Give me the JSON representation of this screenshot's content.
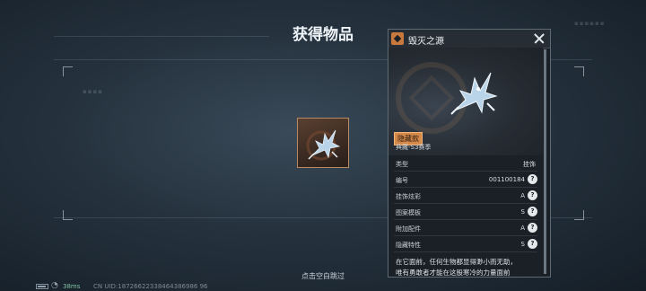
{
  "screen": {
    "title": "获得物品",
    "skip_hint": "点击空白跳过",
    "ping": "38ms",
    "uid": "CN UID:18726622338464386986 96"
  },
  "panel": {
    "title": "毁灭之源",
    "tag": "隐藏款",
    "collection": "典藏-S3赛季",
    "rows": [
      {
        "label": "类型",
        "value": "挂饰",
        "help": ""
      },
      {
        "label": "编号",
        "value": "001100184",
        "help": "?"
      },
      {
        "label": "挂饰炫彩",
        "value": "A",
        "help": "?"
      },
      {
        "label": "图案模板",
        "value": "S",
        "help": "?"
      },
      {
        "label": "附加配件",
        "value": "A",
        "help": "?"
      },
      {
        "label": "隐藏特性",
        "value": "S",
        "help": "?"
      }
    ],
    "description_line1": "在它面前，任何生物都显得渺小而无助，",
    "description_line2": "唯有勇敢者才能在这股寒冷的力量面前"
  },
  "colors": {
    "accent_orange": "#d58a4a",
    "panel_bg": "#1b2026",
    "background": "#25323e"
  },
  "icons": {
    "item": "dragon-ornament-icon",
    "close": "close-icon",
    "help": "question-mark-icon",
    "rarity": "diamond-badge-icon"
  }
}
